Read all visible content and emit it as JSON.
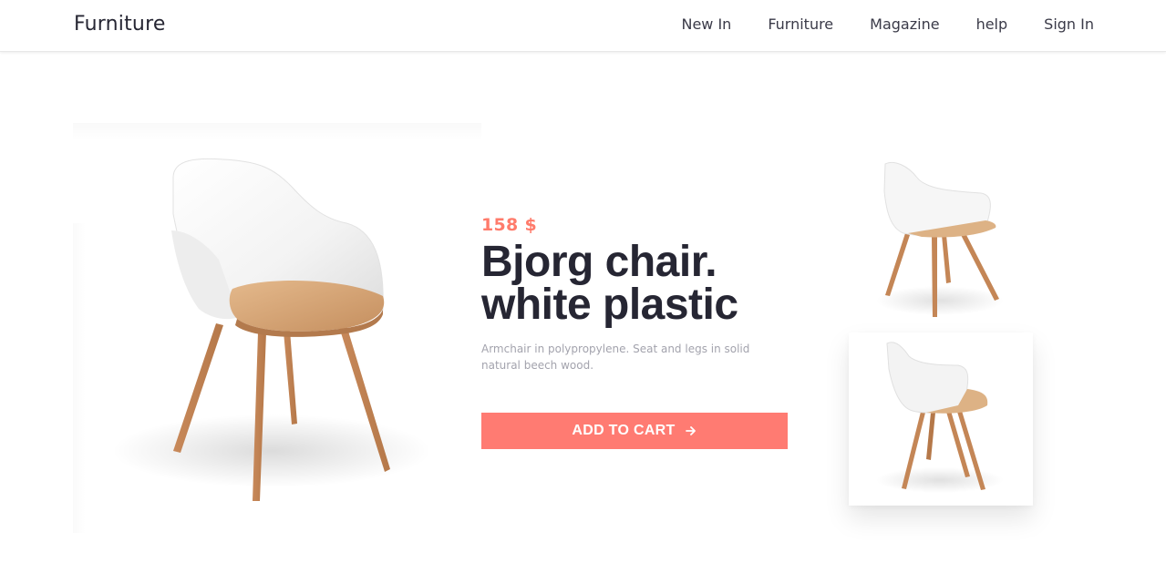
{
  "header": {
    "logo": "Furniture",
    "nav": [
      "New In",
      "Furniture",
      "Magazine",
      "help",
      "Sign In"
    ]
  },
  "product": {
    "price": "158 $",
    "title_line1": "Bjorg chair.",
    "title_line2": "white plastic",
    "description": "Armchair in polypropylene. Seat and legs in solid natural beech wood.",
    "cta_label": "ADD TO CART"
  },
  "colors": {
    "accent": "#ff7b72",
    "price": "#ff7b6b",
    "text_dark": "#262633",
    "text_muted": "#a3a3ad"
  }
}
